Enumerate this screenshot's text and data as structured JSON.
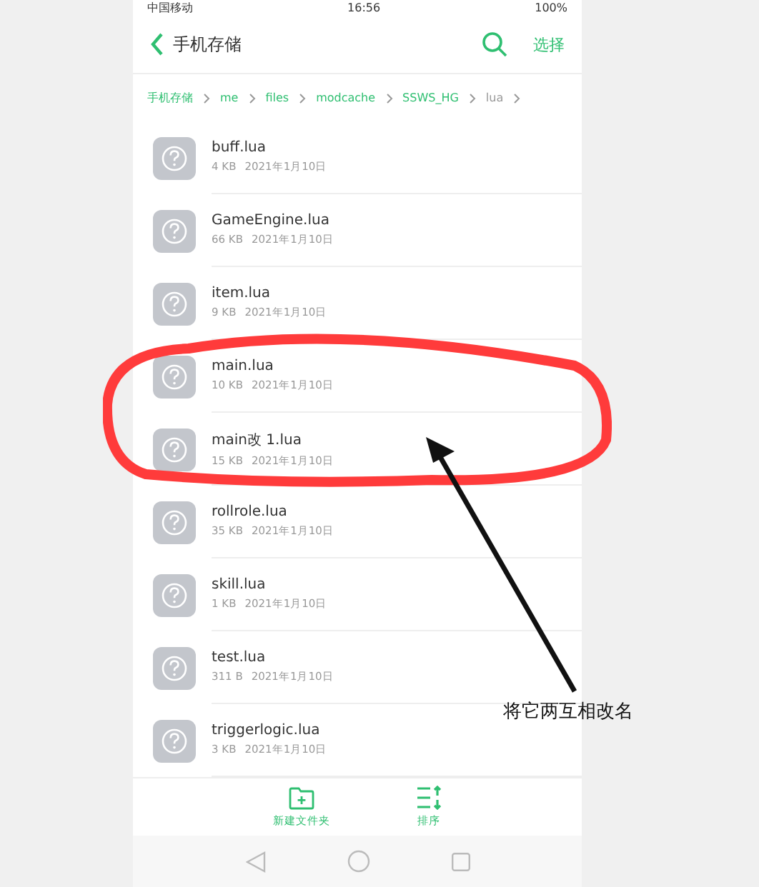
{
  "status_bar": {
    "carrier": "中国移动",
    "time": "16:56",
    "battery": "100%"
  },
  "header": {
    "title": "手机存储",
    "action": "选择"
  },
  "breadcrumb": [
    {
      "label": "手机存储",
      "selected": false
    },
    {
      "label": "me",
      "selected": false
    },
    {
      "label": "files",
      "selected": false
    },
    {
      "label": "modcache",
      "selected": false
    },
    {
      "label": "SSWS_HG",
      "selected": false
    },
    {
      "label": "lua",
      "selected": true
    }
  ],
  "files": [
    {
      "name": "buff.lua",
      "size": "4 KB",
      "date": "2021年1月10日"
    },
    {
      "name": "GameEngine.lua",
      "size": "66 KB",
      "date": "2021年1月10日"
    },
    {
      "name": "item.lua",
      "size": "9 KB",
      "date": "2021年1月10日"
    },
    {
      "name": "main.lua",
      "size": "10 KB",
      "date": "2021年1月10日"
    },
    {
      "name": "main改 1.lua",
      "size": "15 KB",
      "date": "2021年1月10日"
    },
    {
      "name": "rollrole.lua",
      "size": "35 KB",
      "date": "2021年1月10日"
    },
    {
      "name": "skill.lua",
      "size": "1 KB",
      "date": "2021年1月10日"
    },
    {
      "name": "test.lua",
      "size": "311 B",
      "date": "2021年1月10日"
    },
    {
      "name": "triggerlogic.lua",
      "size": "3 KB",
      "date": "2021年1月10日"
    }
  ],
  "toolbar": [
    {
      "label": "新建文件夹",
      "kind": "new-folder"
    },
    {
      "label": "排序",
      "kind": "sort"
    }
  ],
  "annotation": {
    "caption": "将它两互相改名"
  }
}
